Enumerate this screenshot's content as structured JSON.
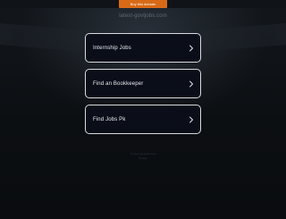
{
  "topbar": {
    "buy_label": "Buy this domain"
  },
  "domain": "latest-govtjobs.com",
  "links": [
    {
      "label": "Internship Jobs",
      "icon": "chevron-right-icon"
    },
    {
      "label": "Find an Bookkeeper",
      "icon": "chevron-right-icon"
    },
    {
      "label": "Find Jobs Pk",
      "icon": "chevron-right-icon"
    }
  ],
  "footer": {
    "line1": "© latest-govtjobs.com",
    "line2": "Privacy"
  },
  "colors": {
    "background": "#0c0f12",
    "card_border": "#d7dadf",
    "buy_banner": "#d86a17"
  }
}
